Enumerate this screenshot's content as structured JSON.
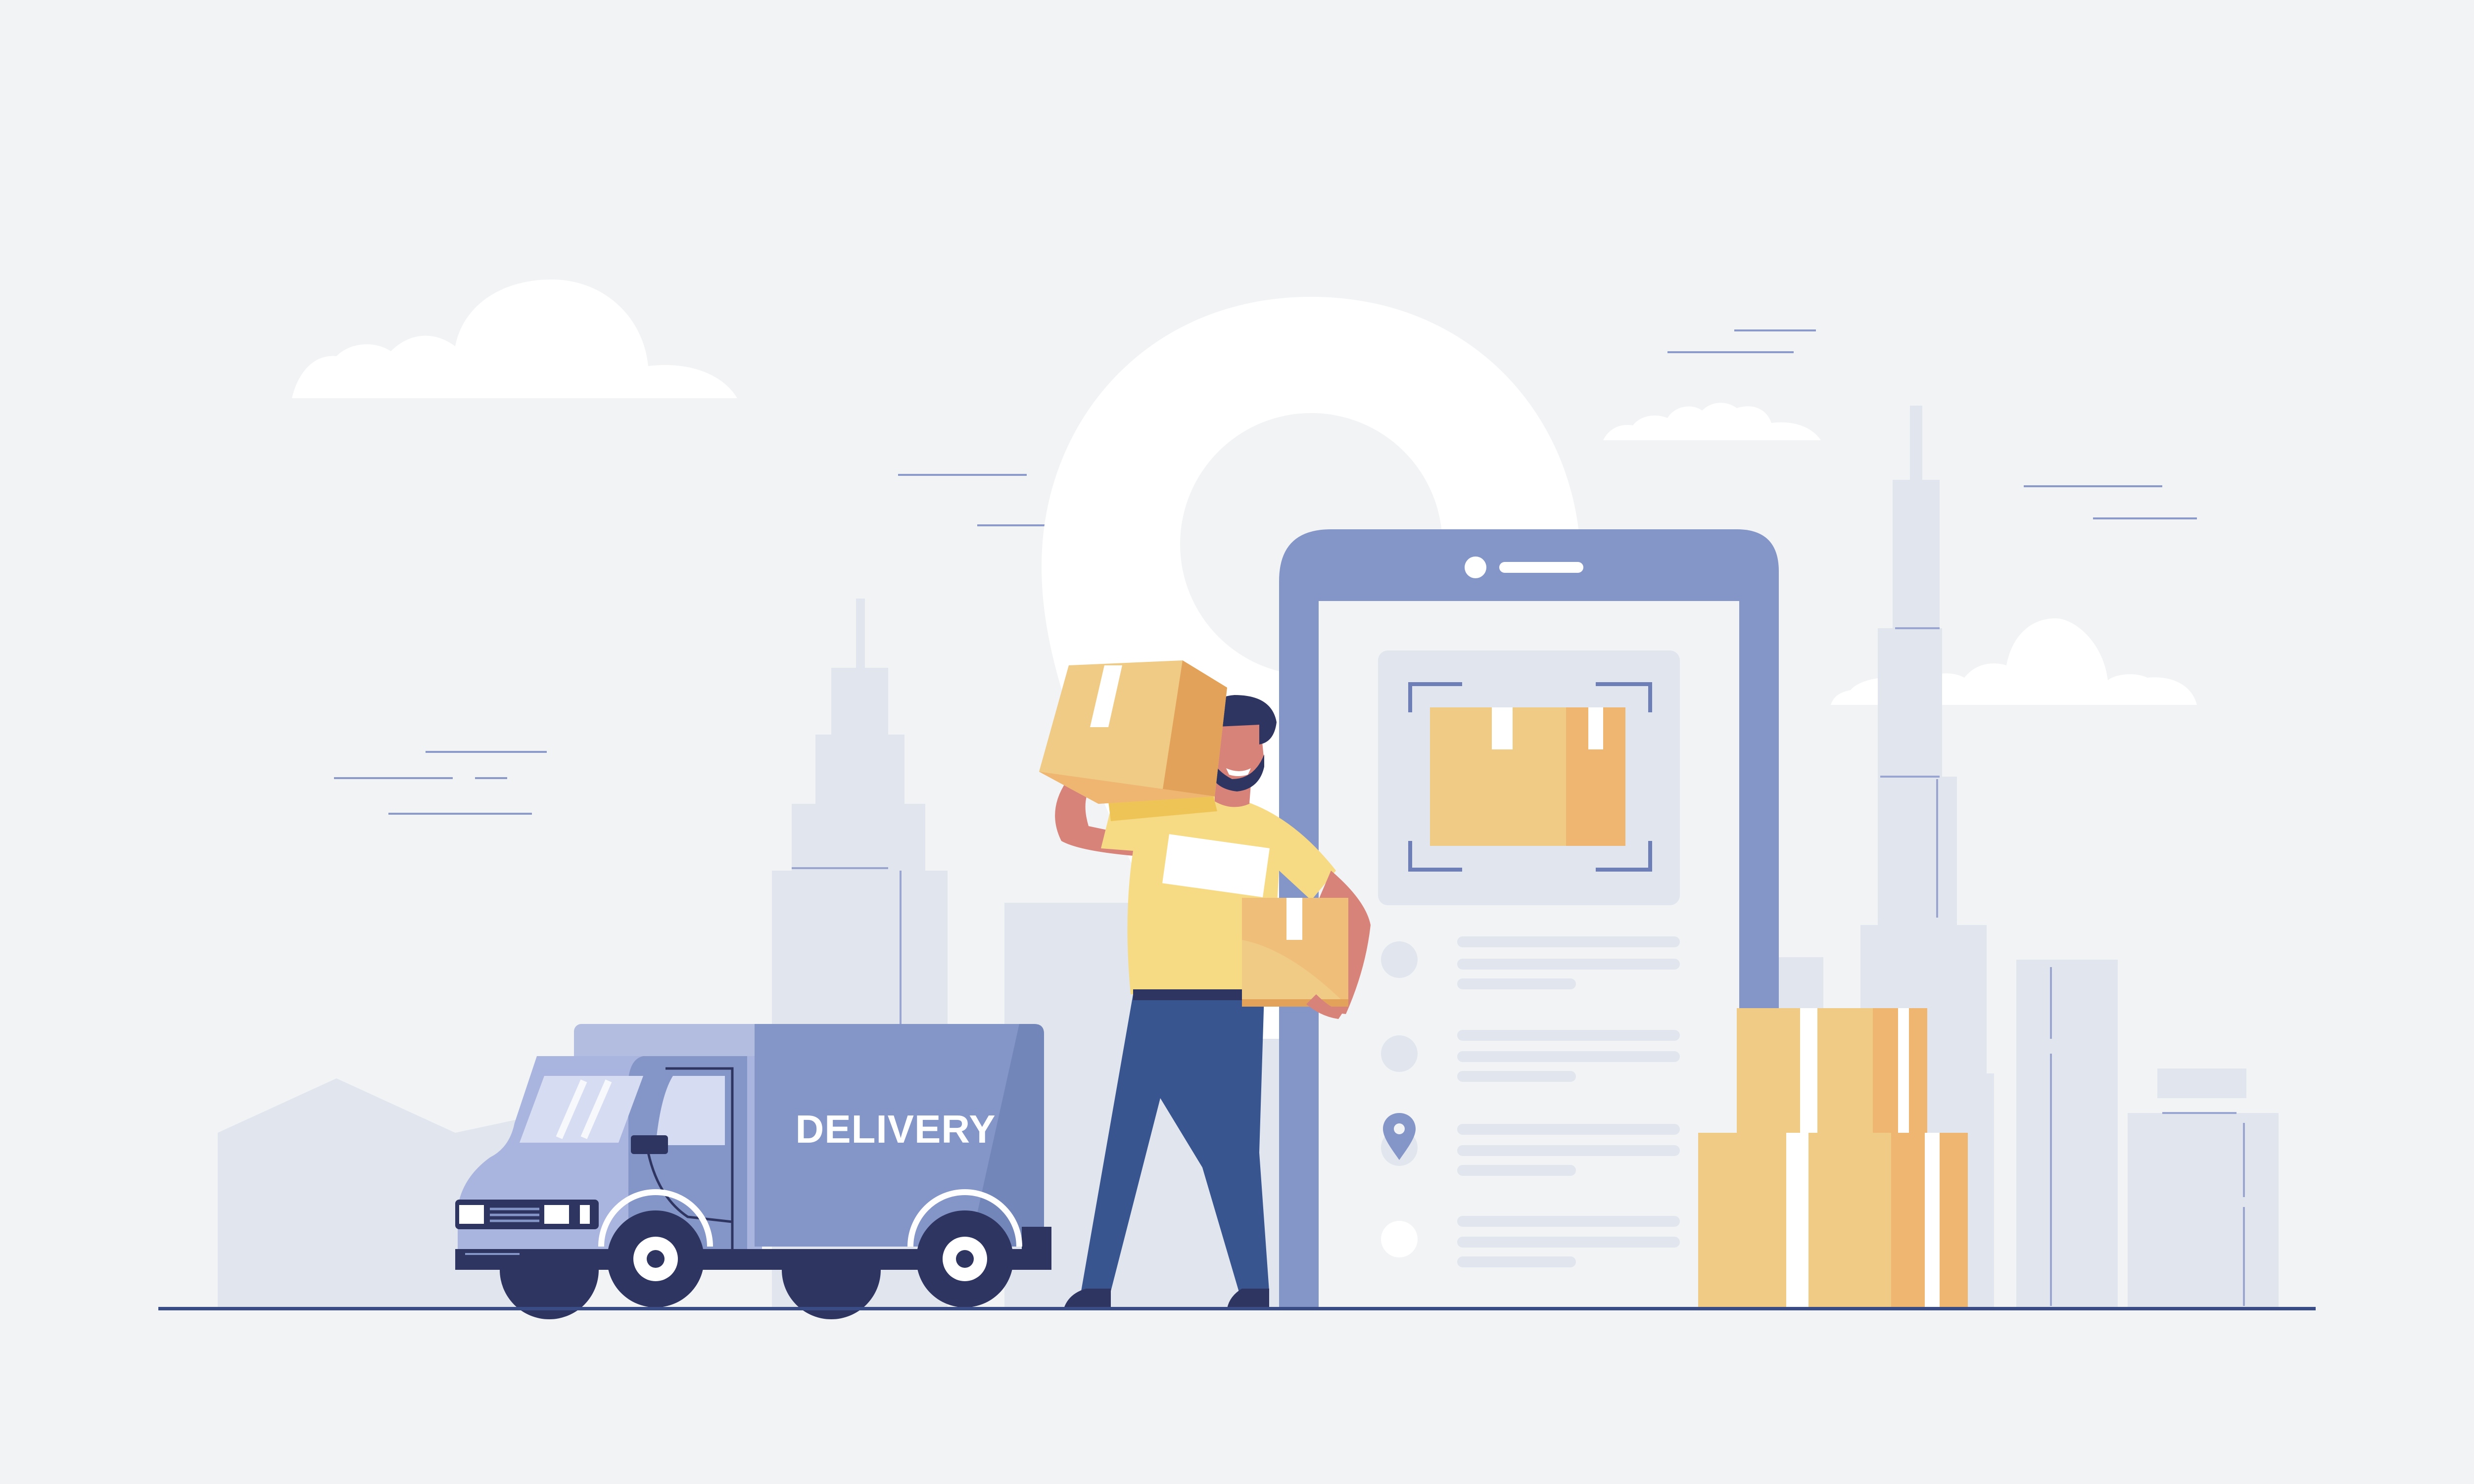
{
  "truck": {
    "label": "DELIVERY"
  },
  "colors": {
    "background": "#F2F3F5",
    "building": "#E1E5EE",
    "truck_body": "#8495C7",
    "truck_dark": "#2F3561",
    "phone_frame": "#8495C7",
    "box_light": "#F0CB86",
    "box_dark": "#EEB670",
    "shirt": "#F6DA84",
    "pants": "#38558F",
    "skin": "#D7837A",
    "hair": "#2F3561",
    "ground_line": "#3A4C86",
    "cloud": "#FFFFFF"
  },
  "icons": {
    "phone_screen_pin": "location-pin-icon",
    "scan_frame": "scan-frame-icon"
  }
}
